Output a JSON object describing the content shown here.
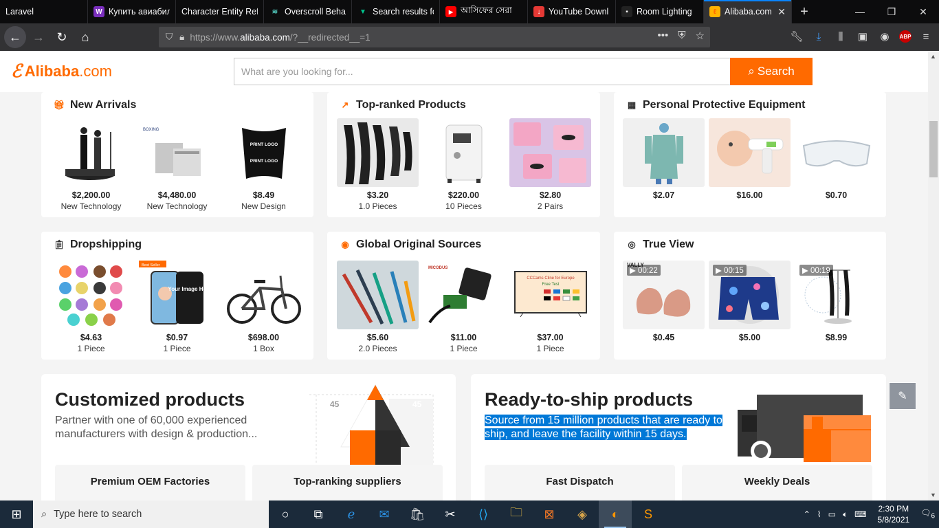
{
  "tabs": [
    {
      "label": "Laravel",
      "favicon": "laravel-favicon",
      "color": "#0c0c0d"
    },
    {
      "label": "Купить авиабил",
      "favicon": "w-favicon",
      "color": "#7b2fbe"
    },
    {
      "label": "Character Entity Refe",
      "favicon": "blank-favicon",
      "color": "#0c0c0d"
    },
    {
      "label": "Overscroll Behav",
      "favicon": "wave-favicon",
      "color": "#4fc3b7"
    },
    {
      "label": "Search results fo",
      "favicon": "v-favicon",
      "color": "#00c58e"
    },
    {
      "label": "আসিফের সেরা",
      "favicon": "youtube-favicon",
      "color": "#ff0000"
    },
    {
      "label": "YouTube Downl",
      "favicon": "download-favicon",
      "color": "#e53935"
    },
    {
      "label": "Room Lighting",
      "favicon": "room-favicon",
      "color": "#333"
    },
    {
      "label": "Alibaba.com",
      "favicon": "alibaba-favicon",
      "color": "#ffb300"
    }
  ],
  "url": {
    "prefix": "https://www.",
    "domain": "alibaba.com",
    "path": "/?__redirected__=1"
  },
  "header": {
    "logo_text": "Alibaba",
    "logo_suffix": ".com",
    "search_placeholder": "What are you looking for...",
    "search_button": "Search"
  },
  "cards": [
    {
      "title": "New Arrivals",
      "icon": "gift-icon",
      "items": [
        {
          "price": "$2,200.00",
          "sub": "New Technology"
        },
        {
          "price": "$4,480.00",
          "sub": "New Technology"
        },
        {
          "price": "$8.49",
          "sub": "New Design"
        }
      ]
    },
    {
      "title": "Top-ranked Products",
      "icon": "trend-up-icon",
      "items": [
        {
          "price": "$3.20",
          "sub": "1.0 Pieces"
        },
        {
          "price": "$220.00",
          "sub": "10 Pieces"
        },
        {
          "price": "$2.80",
          "sub": "2 Pairs"
        }
      ]
    },
    {
      "title": "Personal Protective Equipment",
      "icon": "building-icon",
      "items": [
        {
          "price": "$2.07",
          "sub": ""
        },
        {
          "price": "$16.00",
          "sub": ""
        },
        {
          "price": "$0.70",
          "sub": ""
        }
      ]
    },
    {
      "title": "Dropshipping",
      "icon": "clipboard-icon",
      "items": [
        {
          "price": "$4.63",
          "sub": "1 Piece"
        },
        {
          "price": "$0.97",
          "sub": "1 Piece"
        },
        {
          "price": "$698.00",
          "sub": "1 Box"
        }
      ]
    },
    {
      "title": "Global Original Sources",
      "icon": "globe-icon",
      "items": [
        {
          "price": "$5.60",
          "sub": "2.0 Pieces"
        },
        {
          "price": "$11.00",
          "sub": "1 Piece"
        },
        {
          "price": "$37.00",
          "sub": "1 Piece"
        }
      ]
    },
    {
      "title": "True View",
      "icon": "eye-icon",
      "items": [
        {
          "price": "$0.45",
          "sub": "",
          "video": "00:22"
        },
        {
          "price": "$5.00",
          "sub": "",
          "video": "00:15"
        },
        {
          "price": "$8.99",
          "sub": "",
          "video": "00:19"
        }
      ]
    }
  ],
  "image_text": {
    "hoodie_print_1": "PRINT LOGO",
    "hoodie_print_2": "PRINT LOGO",
    "miner_brand": "BOXING",
    "best_seller": "Best Seller",
    "phone_text": "Your Image Here",
    "gps_brand": "MICODUS",
    "tv_title": "CCCams Cline for Europe",
    "tv_sub": "Free Test",
    "vally": "VALLY"
  },
  "customized": {
    "title": "Customized products",
    "desc": "Partner with one of 60,000 experienced manufacturers with design & production...",
    "pills": [
      "Premium OEM Factories",
      "Top-ranking suppliers"
    ],
    "angle_left": "45",
    "angle_right": "45"
  },
  "ready": {
    "title": "Ready-to-ship products",
    "desc": "Source from 15 million products that are ready to ship, and leave the facility within 15 days.",
    "pills": [
      "Fast Dispatch",
      "Weekly Deals"
    ]
  },
  "taskbar": {
    "search_placeholder": "Type here to search",
    "time": "2:30 PM",
    "date": "5/8/2021",
    "notifications": "6"
  }
}
